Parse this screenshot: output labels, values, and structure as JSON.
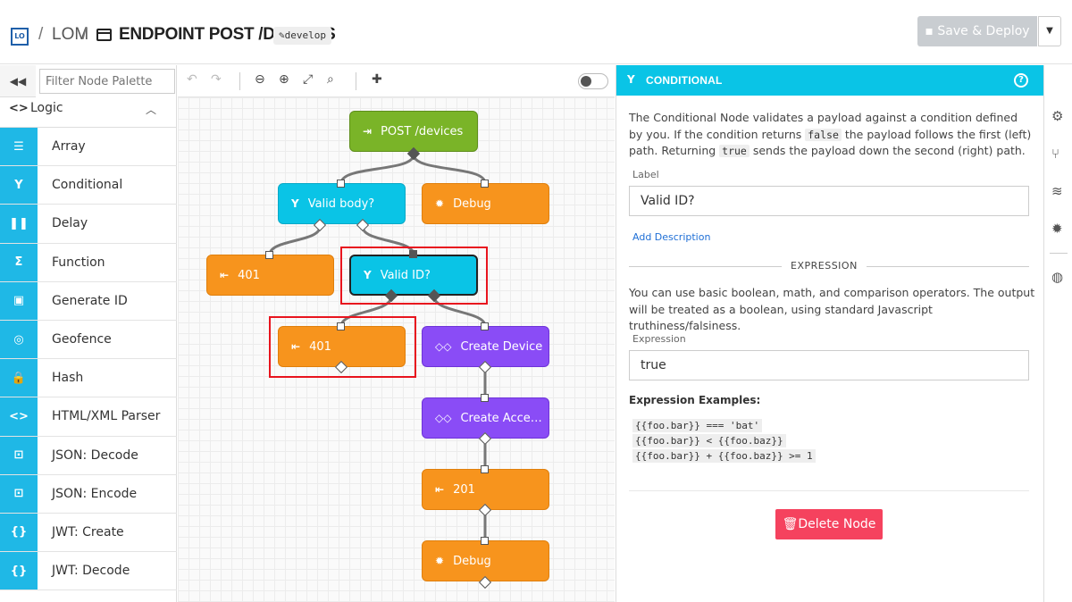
{
  "header": {
    "logo": "LO",
    "crumb_sep1": "/",
    "app": "LOM",
    "crumb_sep2": "/",
    "title": "ENDPOINT POST /DEVICES",
    "branch": "✎develop",
    "save_label": "Save & Deploy",
    "dropdown_glyph": "▼"
  },
  "palette": {
    "collapse_glyph": "◀◀",
    "filter_placeholder": "Filter Node Palette",
    "group": {
      "icon": "<>",
      "label": "Logic",
      "chevron": "︿"
    },
    "items": [
      {
        "icon": "☰",
        "label": "Array"
      },
      {
        "icon": "Y",
        "label": "Conditional"
      },
      {
        "icon": "❚❚",
        "label": "Delay"
      },
      {
        "icon": "Σ",
        "label": "Function"
      },
      {
        "icon": "▣",
        "label": "Generate ID"
      },
      {
        "icon": "◎",
        "label": "Geofence"
      },
      {
        "icon": "🔒",
        "label": "Hash"
      },
      {
        "icon": "<>",
        "label": "HTML/XML Parser"
      },
      {
        "icon": "⊡",
        "label": "JSON: Decode"
      },
      {
        "icon": "⊡",
        "label": "JSON: Encode"
      },
      {
        "icon": "{}",
        "label": "JWT: Create"
      },
      {
        "icon": "{}",
        "label": "JWT: Decode"
      }
    ]
  },
  "canvas": {
    "toolbar": {
      "undo": "↶",
      "redo": "↷",
      "zoom_out": "⊖",
      "zoom_in": "⊕",
      "fit": "⤢",
      "zoom_reset": "⌕",
      "comment": "✚"
    },
    "nodes": {
      "post": {
        "label": "POST /devices",
        "icon": "⇥"
      },
      "valid_body": {
        "label": "Valid body?",
        "icon": "Y"
      },
      "debug1": {
        "label": "Debug",
        "icon": "✹"
      },
      "r401a": {
        "label": "401",
        "icon": "⇤"
      },
      "valid_id": {
        "label": "Valid ID?",
        "icon": "Y"
      },
      "r401b": {
        "label": "401",
        "icon": "⇤"
      },
      "create_device": {
        "label": "Create Device",
        "icon": "◇◇"
      },
      "create_access": {
        "label": "Create Acce…",
        "icon": "◇◇"
      },
      "r201": {
        "label": "201",
        "icon": "⇤"
      },
      "debug2": {
        "label": "Debug",
        "icon": "✹"
      }
    },
    "colors": {
      "green": "#7ab428",
      "blue": "#0ac4e6",
      "orange": "#f7941d",
      "purple": "#8a4cf6",
      "highlight": "#e8141e"
    }
  },
  "panel": {
    "icon": "Y",
    "title": "CONDITIONAL",
    "help": "?",
    "desc_1": "The Conditional Node validates a payload against a condition defined by you. If the condition returns ",
    "desc_code_1": "false",
    "desc_2": " the payload follows the first (left) path. Returning ",
    "desc_code_2": "true",
    "desc_3": " sends the payload down the second (right) path.",
    "label_caption": "Label",
    "label_value": "Valid ID?",
    "add_description": "Add Description",
    "section": "EXPRESSION",
    "expr_desc": "You can use basic boolean, math, and comparison operators. The output will be treated as a boolean, using standard Javascript truthiness/falsiness.",
    "expression_caption": "Expression",
    "expression_value": "true",
    "examples_title": "Expression Examples:",
    "examples": [
      "{{foo.bar}} === 'bat'",
      "{{foo.bar}} < {{foo.baz}}",
      "{{foo.bar}} + {{foo.baz}} >= 1"
    ],
    "delete_label": "Delete Node",
    "delete_icon": "🗑"
  },
  "rail": {
    "icons": [
      "⚙",
      "⑂",
      "≋",
      "✹",
      "◍"
    ]
  }
}
